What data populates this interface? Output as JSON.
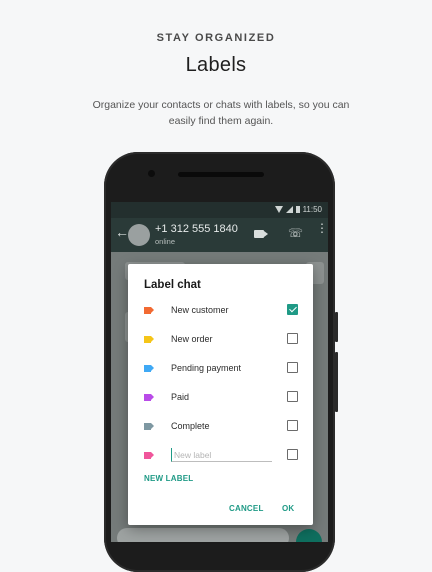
{
  "header": {
    "eyebrow": "STAY ORGANIZED",
    "title": "Labels",
    "description": "Organize your contacts or chats with labels, so you can easily find them again."
  },
  "phone": {
    "status_time": "11:50",
    "contact_name": "+1 312 555 1840",
    "contact_status": "online"
  },
  "dialog": {
    "title": "Label chat",
    "labels": [
      {
        "name": "New customer",
        "color": "#f26a32",
        "checked": true
      },
      {
        "name": "New order",
        "color": "#f5c518",
        "checked": false
      },
      {
        "name": "Pending payment",
        "color": "#3fa9f5",
        "checked": false
      },
      {
        "name": "Paid",
        "color": "#b94be8",
        "checked": false
      },
      {
        "name": "Complete",
        "color": "#7e98a2",
        "checked": false
      }
    ],
    "new_label_color": "#f0569b",
    "new_label_placeholder": "New label",
    "new_label_link": "NEW LABEL",
    "cancel": "CANCEL",
    "ok": "OK"
  },
  "colors": {
    "accent": "#1f9a86",
    "appbar": "#2a3a38"
  }
}
